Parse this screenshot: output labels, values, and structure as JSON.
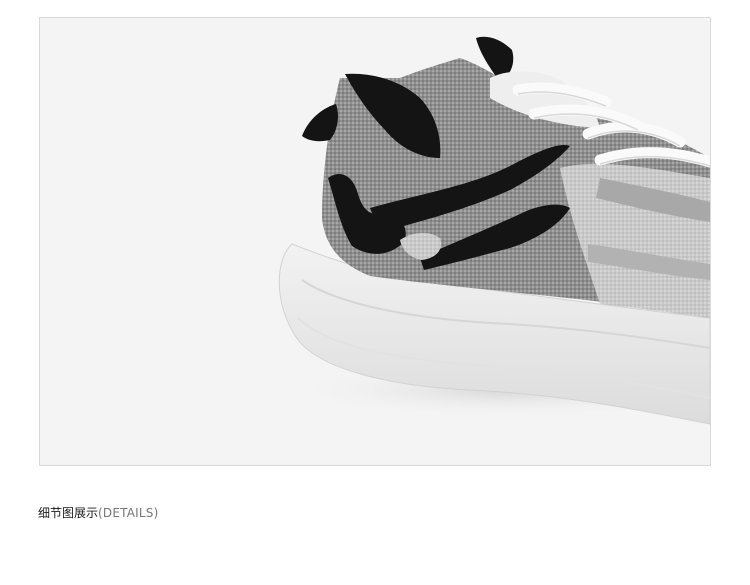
{
  "detail_section": {
    "image_subject": "sneaker-heel-detail-photo",
    "caption_cn": "细节图展示",
    "caption_en": "(DETAILS)"
  },
  "colors": {
    "frame_border": "#d9d9d9",
    "photo_background": "#f4f4f4",
    "sole": "#ececec",
    "knit_gray": "#9a9a9a",
    "knit_light": "#cfcfcf",
    "trim_black": "#141414",
    "laces": "#fafafa"
  }
}
